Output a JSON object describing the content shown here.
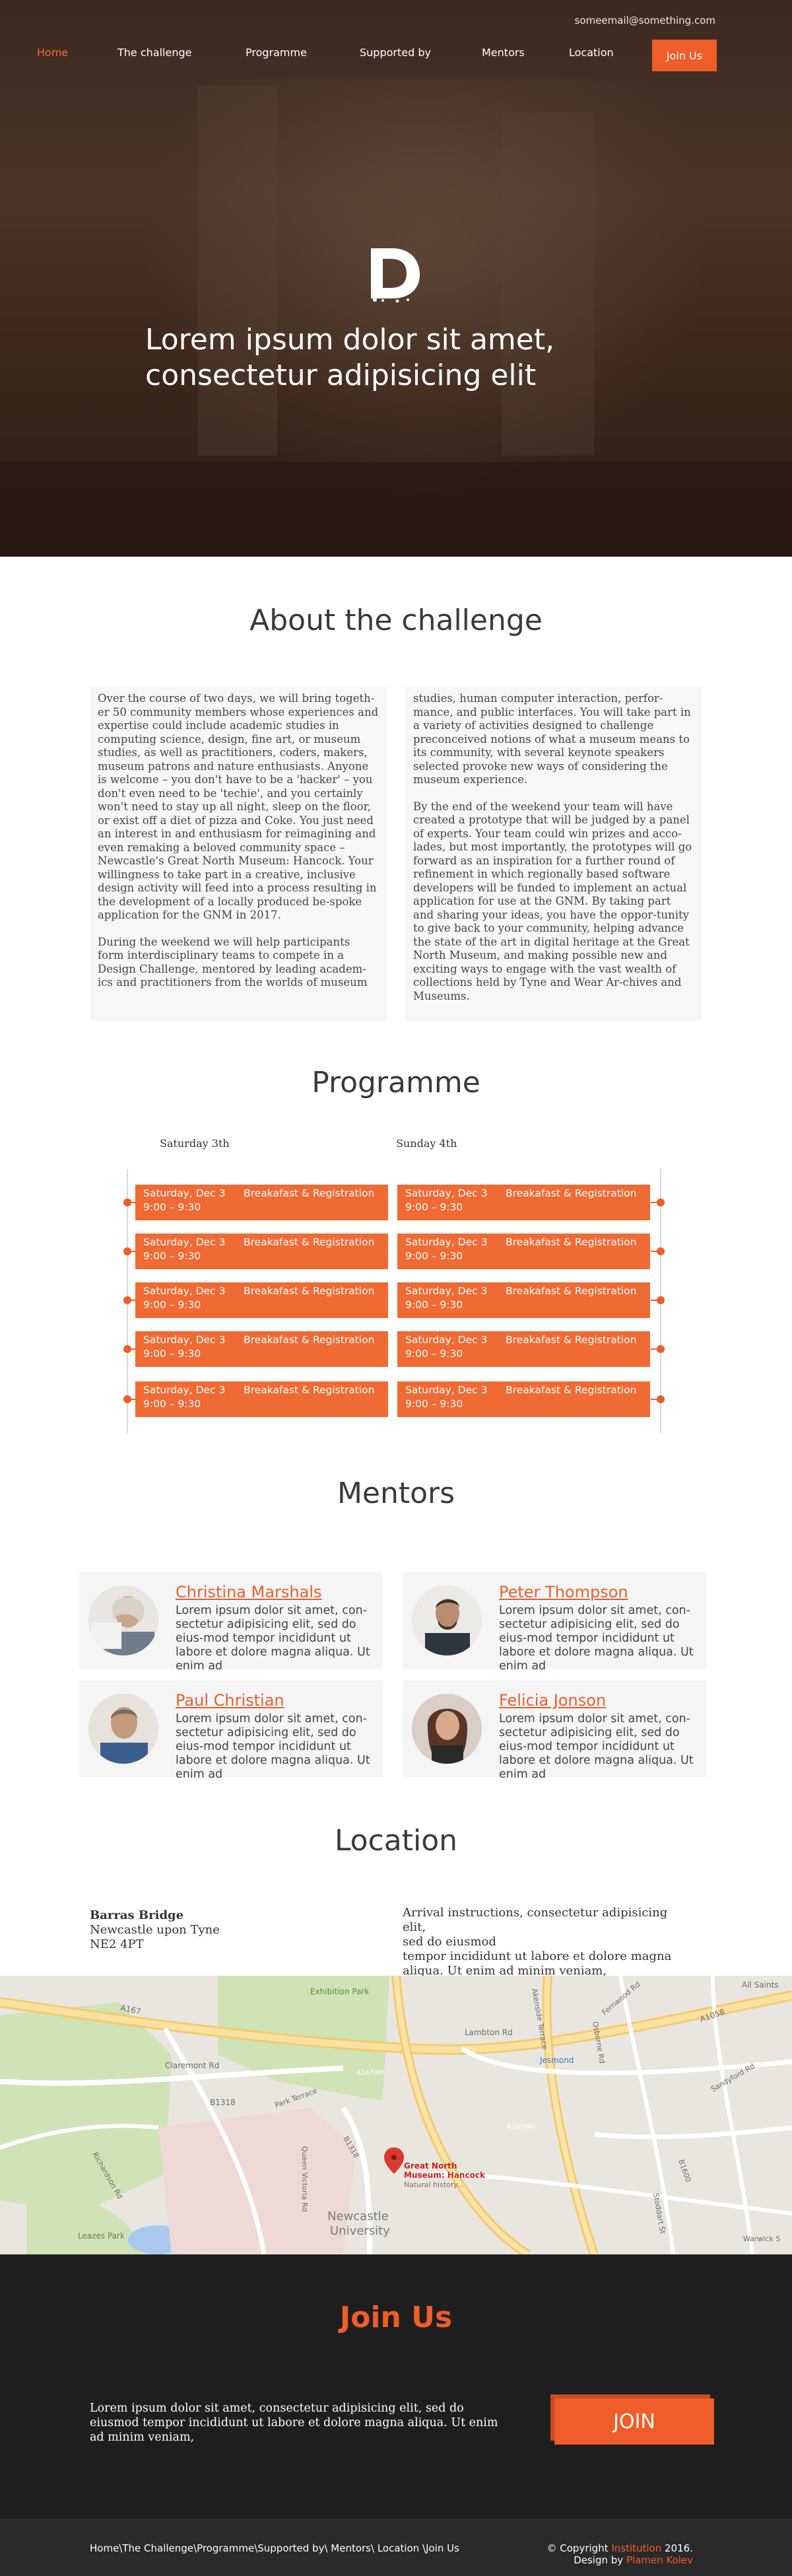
{
  "header": {
    "email": "someemail@something.com",
    "nav": [
      {
        "label": "Home"
      },
      {
        "label": "The challenge"
      },
      {
        "label": "Programme"
      },
      {
        "label": "Supported by"
      },
      {
        "label": "Mentors"
      },
      {
        "label": "Location"
      }
    ],
    "join_label": "Join Us"
  },
  "hero": {
    "title_line1": "Lorem ipsum dolor sit amet,",
    "title_line2": "consectetur adipisicing elit"
  },
  "about": {
    "title": "About the challenge",
    "left_p1": "Over the course of two days, we will bring togeth-er 50 community members whose experiences and expertise could include academic studies in computing science, design, fine art, or museum studies, as well as practitioners, coders, makers, museum patrons and nature enthusiasts. Anyone is welcome – you don't have to be a 'hacker' – you don't even need to be 'techie', and you certainly won't need to stay up all night, sleep on the floor, or exist off a diet of pizza and Coke. You just need an interest in and enthusiasm for reimagining and even remaking a beloved community space – Newcastle's Great North Museum: Hancock. Your willingness to take part in a creative, inclusive design activity will feed into a process resulting in the development of a locally produced be-spoke application for the GNM in 2017.",
    "left_p2": "During the weekend we will help participants form interdisciplinary teams to compete in a Design Challenge, mentored by leading academ-ics and practitioners from the worlds of museum",
    "right_p1": "studies, human computer interaction, perfor-mance, and public interfaces.  You will take part in a variety of activities designed to challenge preconceived notions of what a museum means to its community, with several keynote speakers selected provoke new ways of considering the museum experience.",
    "right_p2": "By the end of the weekend your team will have created a prototype that will be judged by a panel of experts. Your team could win prizes and acco-lades, but most importantly, the prototypes will go forward as an inspiration for a further round of refinement in which regionally based software developers will be funded to implement an actual application for use at the GNM. By taking part and sharing your ideas, you have the oppor-tunity to give back to your community, helping advance the state of the art in digital heritage at the Great North Museum, and making possible new and exciting ways to engage with the vast wealth of collections held by Tyne and Wear Ar-chives and Museums."
  },
  "programme": {
    "title": "Programme",
    "day1_label": "Saturday 3th",
    "day2_label": "Sunday 4th",
    "day1": [
      {
        "date": "Saturday, Dec 3",
        "event": "Breakafast & Registration",
        "time": "9:00 – 9:30"
      },
      {
        "date": "Saturday, Dec 3",
        "event": "Breakafast & Registration",
        "time": "9:00 – 9:30"
      },
      {
        "date": "Saturday, Dec 3",
        "event": "Breakafast & Registration",
        "time": "9:00 – 9:30"
      },
      {
        "date": "Saturday, Dec 3",
        "event": "Breakafast & Registration",
        "time": "9:00 – 9:30"
      },
      {
        "date": "Saturday, Dec 3",
        "event": "Breakafast & Registration",
        "time": "9:00 – 9:30"
      }
    ],
    "day2": [
      {
        "date": "Saturday, Dec 3",
        "event": "Breakafast & Registration",
        "time": "9:00 – 9:30"
      },
      {
        "date": "Saturday, Dec 3",
        "event": "Breakafast & Registration",
        "time": "9:00 – 9:30"
      },
      {
        "date": "Saturday, Dec 3",
        "event": "Breakafast & Registration",
        "time": "9:00 – 9:30"
      },
      {
        "date": "Saturday, Dec 3",
        "event": "Breakafast & Registration",
        "time": "9:00 – 9:30"
      },
      {
        "date": "Saturday, Dec 3",
        "event": "Breakafast & Registration",
        "time": "9:00 – 9:30"
      }
    ]
  },
  "mentors": {
    "title": "Mentors",
    "items": [
      {
        "name": "Christina Marshals",
        "bio": "Lorem ipsum dolor sit amet, con-sectetur adipisicing elit, sed do eius-mod tempor incididunt ut labore et dolore magna aliqua. Ut enim ad"
      },
      {
        "name": "Peter Thompson",
        "bio": "Lorem ipsum dolor sit amet, con-sectetur adipisicing elit, sed do eius-mod tempor incididunt ut labore et dolore magna aliqua. Ut enim ad"
      },
      {
        "name": "Paul Christian",
        "bio": "Lorem ipsum dolor sit amet, con-sectetur adipisicing elit, sed do eius-mod tempor incididunt ut labore et dolore magna aliqua. Ut enim ad"
      },
      {
        "name": "Felicia Jonson",
        "bio": "Lorem ipsum dolor sit amet, con-sectetur adipisicing elit, sed do eius-mod tempor incididunt ut labore et dolore magna aliqua. Ut enim ad"
      }
    ]
  },
  "location": {
    "title": "Location",
    "venue": "Barras Bridge",
    "city": "Newcastle upon Tyne",
    "postcode": "NE2 4PT",
    "arrival_line1": "Arrival instructions, consectetur adipisicing elit,",
    "arrival_line2": "sed do eiusmod",
    "arrival_line3": "tempor incididunt ut labore et dolore magna",
    "arrival_line4": "aliqua. Ut enim ad minim veniam,"
  },
  "map": {
    "pin_label_1": "Great North",
    "pin_label_2": "Museum: Hancock",
    "pin_sub": "Natural history...",
    "labels": {
      "a167": "A167",
      "a1058": "A1058",
      "a167m": "A167(M)",
      "a167m2": "A167(M)",
      "exhibition_park": "Exhibition Park",
      "claremont_rd": "Claremont Rd",
      "b1318": "B1318",
      "park_terrace": "Park Terrace",
      "richardson_rd": "Richardson Rd",
      "queen_victoria_rd": "Queen Victoria Rd",
      "b1318b": "B1318",
      "lambton_rd": "Lambton Rd",
      "jesmond": "Jesmond",
      "osborne_rd": "Osborne Rd",
      "fernwood_rd": "Fernwood Rd",
      "all_saints": "All Saints",
      "leazes_park": "Leazes Park",
      "newcastle_1": "Newcastle",
      "newcastle_2": "University",
      "warwick": "Warwick S",
      "sandyford": "Sandyford Rd",
      "stoddart": "Stoddart St",
      "b1600": "B1600",
      "akenside": "Akenside Terrace"
    }
  },
  "join": {
    "title": "Join Us",
    "text": "Lorem ipsum dolor sit amet, consectetur adipisicing elit, sed do eiusmod tempor incididunt ut labore et dolore magna aliqua. Ut enim ad minim veniam,",
    "button": "JOIN"
  },
  "footer": {
    "links": "Home\\The Challenge\\Programme\\Supported by\\ Mentors\\ Location \\Join Us",
    "copy_prefix": "© Copyright ",
    "copy_institution": "Institution",
    "copy_suffix": " 2016.",
    "design_prefix": "Design by ",
    "designer": "Plamen Kolev"
  },
  "colors": {
    "accent": "#ee5d2a",
    "hero_bg": "#3d2a20",
    "dark_bg": "#1f1e1e",
    "footer_bg": "#2b2a2a"
  }
}
